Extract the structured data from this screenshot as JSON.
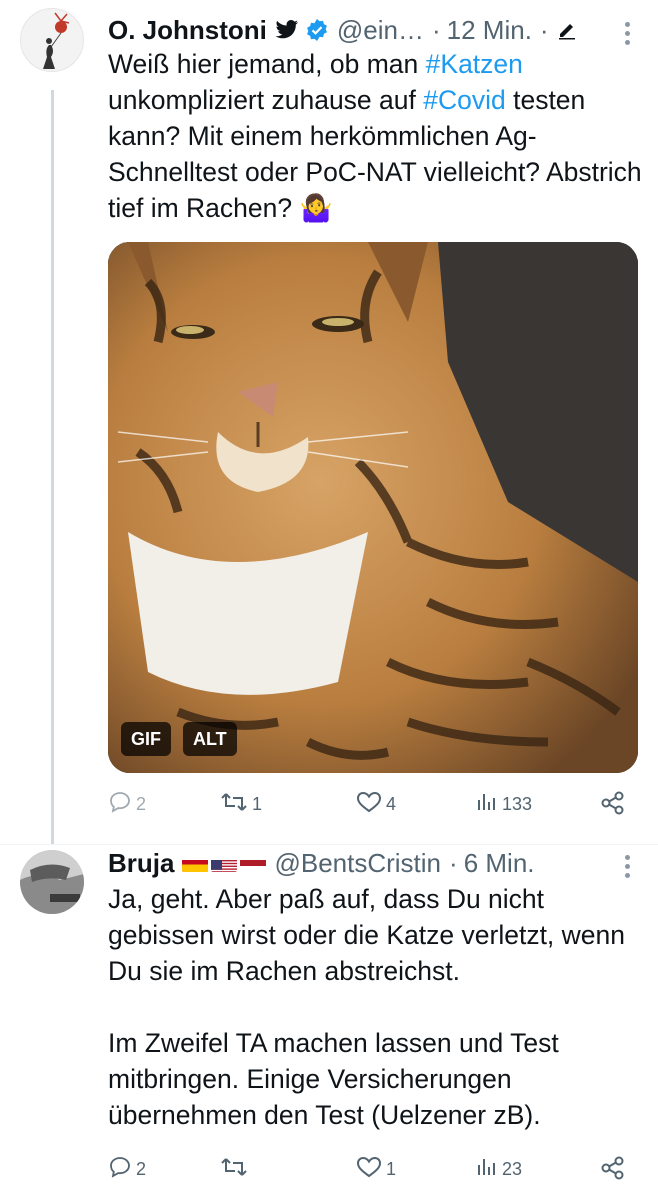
{
  "tweets": [
    {
      "author": "O. Johnstoni",
      "handle": "@ein…",
      "separator": "·",
      "time": "12 Min.",
      "separator2": "·",
      "text_parts": [
        "Weiß hier jemand, ob man ",
        "#Katzen",
        " unkompliziert zuhause auf ",
        "#Covid",
        " testen kann? Mit einem herkömmlichen Ag-Schnelltest oder PoC-NAT vielleicht? Abstrich tief im Rachen? ",
        "🤷‍♀️"
      ],
      "media": {
        "badges": [
          "GIF",
          "ALT"
        ]
      },
      "stats": {
        "replies": "2",
        "retweets": "1",
        "likes": "4",
        "views": "133"
      }
    },
    {
      "author": "Bruja",
      "handle": "@BentsCristin",
      "separator": "·",
      "time": "6 Min.",
      "paragraphs": [
        "Ja, geht. Aber paß auf, dass Du nicht gebissen wirst oder die Katze verletzt, wenn Du sie im Rachen abstreichst.",
        "Im Zweifel TA machen lassen und Test mitbringen. Einige Versicherungen übernehmen den Test (Uelzener zB)."
      ],
      "stats": {
        "replies": "2",
        "retweets": "",
        "likes": "1",
        "views": "23"
      }
    }
  ],
  "icons": {
    "bird": "twitter-bird-icon",
    "verified": "verified-badge-icon",
    "edit": "edit-pencil-icon",
    "more": "more-vertical-icon",
    "reply": "reply-icon",
    "retweet": "retweet-icon",
    "like": "heart-icon",
    "views": "views-chart-icon",
    "share": "share-icon"
  },
  "colors": {
    "text": "#0f1419",
    "secondary": "#536471",
    "link": "#1d9bf0",
    "divider": "#eff3f4"
  }
}
